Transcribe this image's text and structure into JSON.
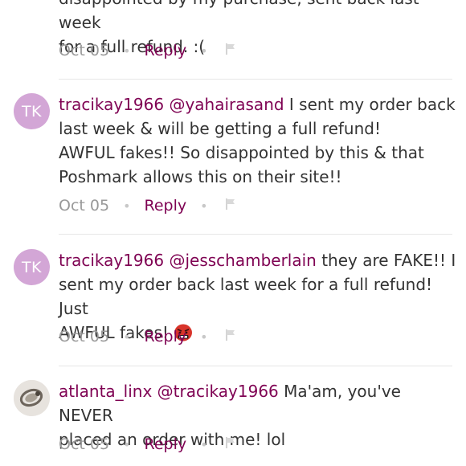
{
  "comments": [
    {
      "line1": "disappointed by my purchase, sent back last week",
      "line2": "for a full refund. :(",
      "date": "Oct 05",
      "reply": "Reply"
    },
    {
      "avatar": "TK",
      "user": "tracikay1966",
      "mention": "@yahairasand",
      "text_a": " I sent my order back",
      "line2": "last week & will be getting a full refund!",
      "line3": "AWFUL fakes!! So disappointed by this & that",
      "line4": "Poshmark allows this on their site!!",
      "date": "Oct 05",
      "reply": "Reply"
    },
    {
      "avatar": "TK",
      "user": "tracikay1966",
      "mention": "@jesschamberlain",
      "text_a": " they are FAKE!! I",
      "line2": "sent my order back last week for a full refund! Just",
      "line3": "AWFUL fakes!",
      "emoji": "angry-face-emoji",
      "date": "Oct 05",
      "reply": "Reply"
    },
    {
      "user": "atlanta_linx",
      "mention": "@tracikay1966",
      "text_a": " Ma'am, you've NEVER",
      "line2": "placed an order with me! lol",
      "date": "Oct 05",
      "reply": "Reply"
    }
  ],
  "colors": {
    "accent": "#7f0353",
    "avatar_bg": "#d3a6d6",
    "meta_gray": "#999999"
  },
  "icons": [
    "flag-icon",
    "separator-dot"
  ]
}
